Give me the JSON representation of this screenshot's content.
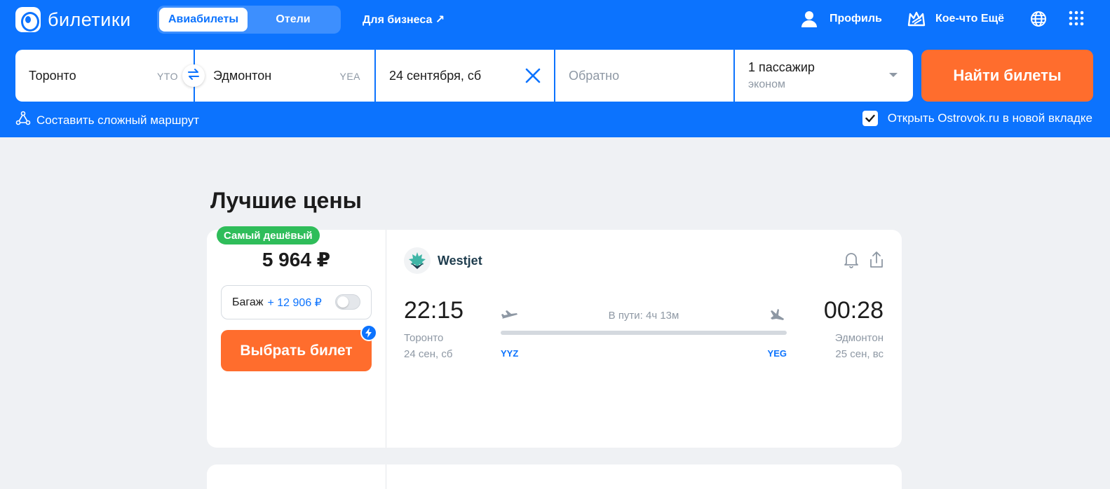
{
  "header": {
    "logo_text": "билетики",
    "tabs": [
      {
        "label": "Авиабилеты",
        "active": true
      },
      {
        "label": "Отели",
        "active": false
      }
    ],
    "business_link": "Для бизнеса ↗",
    "profile_label": "Профиль",
    "more_label": "Кое-что Ещё"
  },
  "search": {
    "from_city": "Торонто",
    "from_code": "YTO",
    "to_city": "Эдмонтон",
    "to_code": "YEA",
    "date": "24 сентября, сб",
    "return_placeholder": "Обратно",
    "passengers": "1 пассажир",
    "cabin_class": "эконом",
    "find_button": "Найти билеты",
    "complex_route": "Составить сложный маршрут",
    "open_ostrovok": "Открыть Ostrovok.ru в новой вкладке",
    "open_ostrovok_checked": true
  },
  "results": {
    "section_title": "Лучшие цены",
    "tickets": [
      {
        "badge": "Самый дешёвый",
        "price": "5 964 ₽",
        "baggage_label": "Багаж",
        "baggage_price": "+ 12 906 ₽",
        "baggage_enabled": false,
        "choose_button": "Выбрать билет",
        "airline": "Westjet",
        "departure_time": "22:15",
        "departure_city": "Торонто",
        "departure_date": "24 сен, сб",
        "departure_code": "YYZ",
        "duration": "В пути: 4ч 13м",
        "arrival_time": "00:28",
        "arrival_city": "Эдмонтон",
        "arrival_date": "25 сен, вс",
        "arrival_code": "YEG"
      }
    ]
  },
  "colors": {
    "brand_blue": "#0c73fe",
    "orange_cta": "#ff6d2d",
    "badge_green": "#2fbd5a",
    "page_bg": "#eff1f4"
  }
}
